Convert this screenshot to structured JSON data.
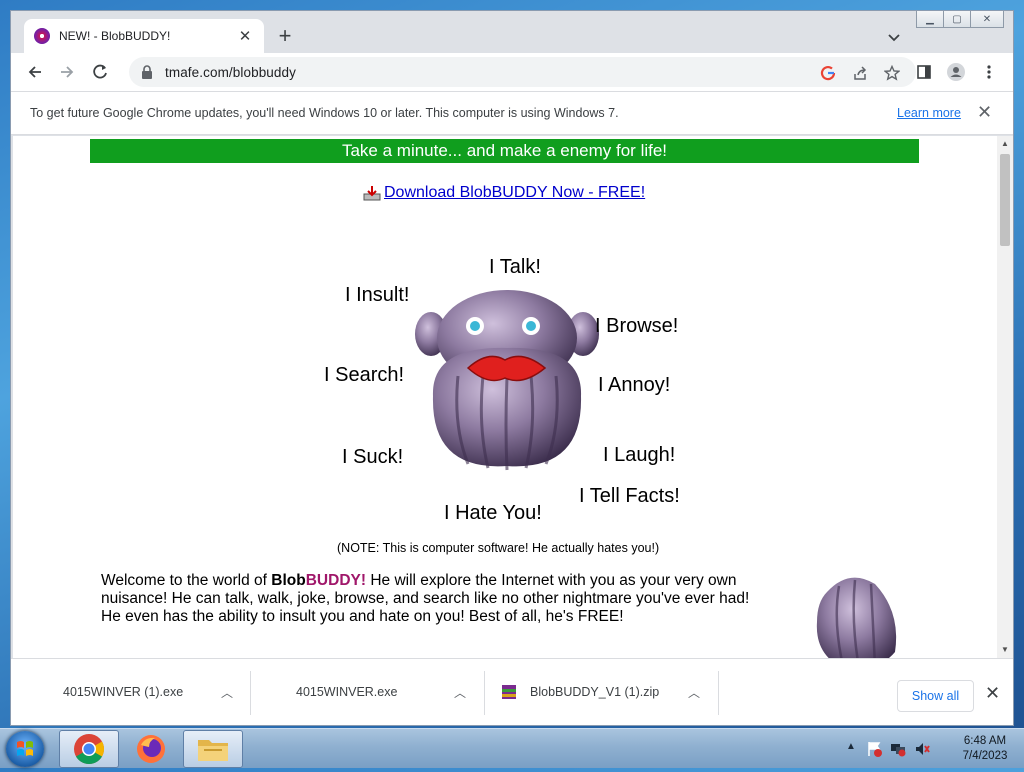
{
  "browser": {
    "tab_title": "NEW! - BlobBUDDY!",
    "url": "tmafe.com/blobbuddy",
    "infobar_message": "To get future Google Chrome updates, you'll need Windows 10 or later. This computer is using Windows 7.",
    "infobar_link": "Learn more"
  },
  "page": {
    "banner": "Take a minute... and make a enemy for life!",
    "download_link": "Download BlobBUDDY Now - FREE!",
    "blob_labels": {
      "talk": "I Talk!",
      "insult": "I Insult!",
      "browse": "I Browse!",
      "search": "I Search!",
      "annoy": "I Annoy!",
      "suck": "I Suck!",
      "laugh": "I Laugh!",
      "tell_facts": "I Tell Facts!",
      "hate": "I Hate You!"
    },
    "note": "(NOTE: This is computer software! He actually hates you!)",
    "welcome": {
      "intro": "Welcome to the world of ",
      "brand_blob": "Blob",
      "brand_buddy": "BUDDY!",
      "rest": " He will explore the Internet with you as your very own nuisance!  He can talk, walk, joke, browse, and search like no other nightmare you've ever had!  He even has the ability to insult you and hate on you! Best of all, he's FREE!"
    }
  },
  "downloads": {
    "items": [
      {
        "name": "4015WINVER (1).exe"
      },
      {
        "name": "4015WINVER.exe"
      },
      {
        "name": "BlobBUDDY_V1 (1).zip"
      }
    ],
    "show_all": "Show all"
  },
  "taskbar": {
    "time": "6:48 AM",
    "date": "7/4/2023"
  },
  "colors": {
    "banner_green": "#109e1e",
    "link_blue": "#0000cc",
    "brand_purple": "#a0176a",
    "chrome_blue": "#1a73e8"
  },
  "icons": [
    "chrome-icon",
    "firefox-icon",
    "folder-icon",
    "winrar-icon",
    "lock-icon",
    "google-icon",
    "share-icon",
    "star-icon",
    "sidepanel-icon",
    "profile-icon",
    "kebab-menu-icon"
  ]
}
